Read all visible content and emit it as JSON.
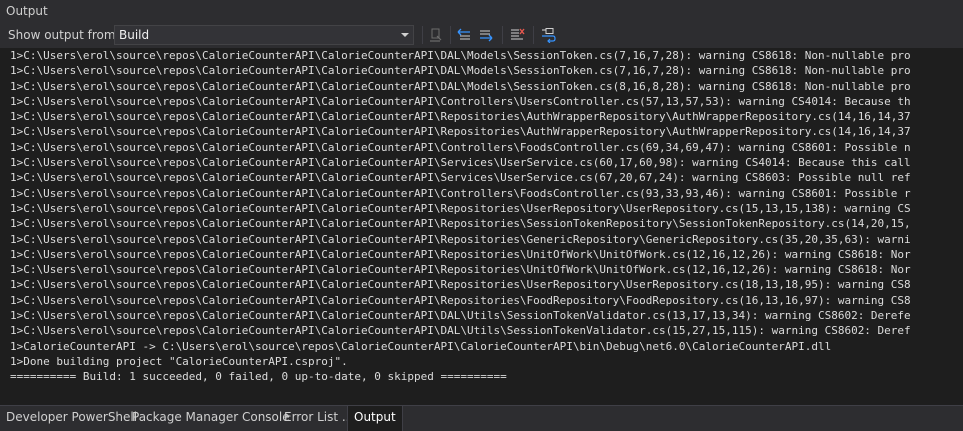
{
  "window": {
    "title": "Output"
  },
  "toolbar": {
    "show_output_label": "Show output from:",
    "source_selected": "Build"
  },
  "icons": {
    "goto": "goto-output-icon",
    "prev": "previous-message-icon",
    "next": "next-message-icon",
    "clear": "clear-all-icon",
    "wrap": "word-wrap-icon"
  },
  "colors": {
    "background": "#1e1e1e",
    "chrome": "#2d2d30",
    "text": "#dcdcdc",
    "accent_blue": "#3794ff",
    "clear_red": "#e8584f"
  },
  "output": {
    "lines": [
      "1>C:\\Users\\erol\\source\\repos\\CalorieCounterAPI\\CalorieCounterAPI\\DAL\\Models\\SessionToken.cs(7,16,7,28): warning CS8618: Non-nullable pro",
      "1>C:\\Users\\erol\\source\\repos\\CalorieCounterAPI\\CalorieCounterAPI\\DAL\\Models\\SessionToken.cs(7,16,7,28): warning CS8618: Non-nullable pro",
      "1>C:\\Users\\erol\\source\\repos\\CalorieCounterAPI\\CalorieCounterAPI\\DAL\\Models\\SessionToken.cs(8,16,8,28): warning CS8618: Non-nullable pro",
      "1>C:\\Users\\erol\\source\\repos\\CalorieCounterAPI\\CalorieCounterAPI\\Controllers\\UsersController.cs(57,13,57,53): warning CS4014: Because th",
      "1>C:\\Users\\erol\\source\\repos\\CalorieCounterAPI\\CalorieCounterAPI\\Repositories\\AuthWrapperRepository\\AuthWrapperRepository.cs(14,16,14,37",
      "1>C:\\Users\\erol\\source\\repos\\CalorieCounterAPI\\CalorieCounterAPI\\Repositories\\AuthWrapperRepository\\AuthWrapperRepository.cs(14,16,14,37",
      "1>C:\\Users\\erol\\source\\repos\\CalorieCounterAPI\\CalorieCounterAPI\\Controllers\\FoodsController.cs(69,34,69,47): warning CS8601: Possible n",
      "1>C:\\Users\\erol\\source\\repos\\CalorieCounterAPI\\CalorieCounterAPI\\Services\\UserService.cs(60,17,60,98): warning CS4014: Because this call",
      "1>C:\\Users\\erol\\source\\repos\\CalorieCounterAPI\\CalorieCounterAPI\\Services\\UserService.cs(67,20,67,24): warning CS8603: Possible null ref",
      "1>C:\\Users\\erol\\source\\repos\\CalorieCounterAPI\\CalorieCounterAPI\\Controllers\\FoodsController.cs(93,33,93,46): warning CS8601: Possible r",
      "1>C:\\Users\\erol\\source\\repos\\CalorieCounterAPI\\CalorieCounterAPI\\Repositories\\UserRepository\\UserRepository.cs(15,13,15,138): warning CS",
      "1>C:\\Users\\erol\\source\\repos\\CalorieCounterAPI\\CalorieCounterAPI\\Repositories\\SessionTokenRepository\\SessionTokenRepository.cs(14,20,15,",
      "1>C:\\Users\\erol\\source\\repos\\CalorieCounterAPI\\CalorieCounterAPI\\Repositories\\GenericRepository\\GenericRepository.cs(35,20,35,63): warni",
      "1>C:\\Users\\erol\\source\\repos\\CalorieCounterAPI\\CalorieCounterAPI\\Repositories\\UnitOfWork\\UnitOfWork.cs(12,16,12,26): warning CS8618: Nor",
      "1>C:\\Users\\erol\\source\\repos\\CalorieCounterAPI\\CalorieCounterAPI\\Repositories\\UnitOfWork\\UnitOfWork.cs(12,16,12,26): warning CS8618: Nor",
      "1>C:\\Users\\erol\\source\\repos\\CalorieCounterAPI\\CalorieCounterAPI\\Repositories\\UserRepository\\UserRepository.cs(18,13,18,95): warning CS8",
      "1>C:\\Users\\erol\\source\\repos\\CalorieCounterAPI\\CalorieCounterAPI\\Repositories\\FoodRepository\\FoodRepository.cs(16,13,16,97): warning CS8",
      "1>C:\\Users\\erol\\source\\repos\\CalorieCounterAPI\\CalorieCounterAPI\\DAL\\Utils\\SessionTokenValidator.cs(13,17,13,34): warning CS8602: Derefe",
      "1>C:\\Users\\erol\\source\\repos\\CalorieCounterAPI\\CalorieCounterAPI\\DAL\\Utils\\SessionTokenValidator.cs(15,27,15,115): warning CS8602: Deref",
      "1>CalorieCounterAPI -> C:\\Users\\erol\\source\\repos\\CalorieCounterAPI\\CalorieCounterAPI\\bin\\Debug\\net6.0\\CalorieCounterAPI.dll",
      "1>Done building project \"CalorieCounterAPI.csproj\".",
      "========== Build: 1 succeeded, 0 failed, 0 up-to-date, 0 skipped =========="
    ]
  },
  "tabs": [
    {
      "label": "Developer PowerShell"
    },
    {
      "label": "Package Manager Console"
    },
    {
      "label": "Error List ..."
    },
    {
      "label": "Output"
    }
  ]
}
